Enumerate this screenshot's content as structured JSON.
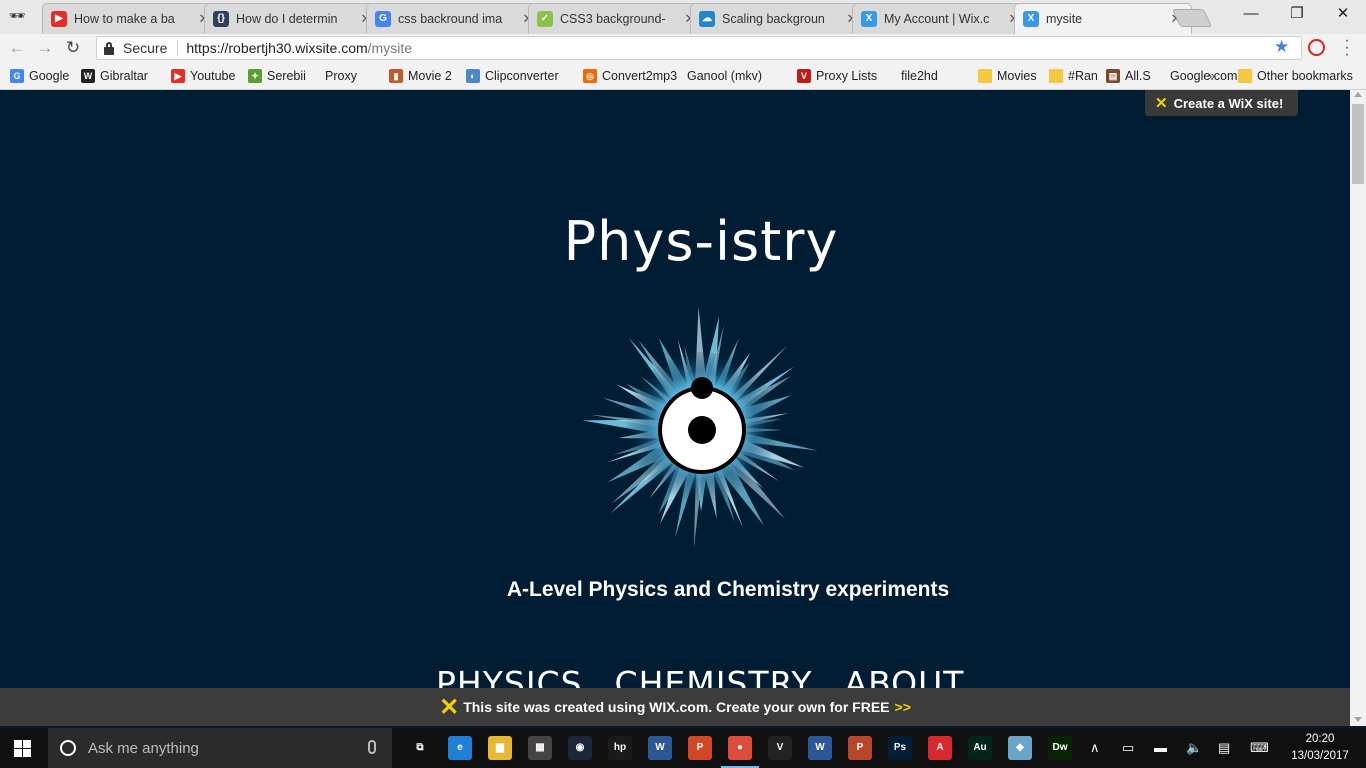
{
  "browser": {
    "tabs": [
      {
        "title": "How to make a ba",
        "icon": "youtube-icon",
        "color": "#e52d27",
        "glyph": "▶"
      },
      {
        "title": "How do I determin",
        "icon": "stackoverflow-icon",
        "color": "#2f3f5c",
        "glyph": "{}"
      },
      {
        "title": "css backround ima",
        "icon": "google-icon",
        "color": "#4285f4",
        "glyph": "G"
      },
      {
        "title": "CSS3 background-",
        "icon": "caniuse-icon",
        "color": "#8bc34a",
        "glyph": "✓"
      },
      {
        "title": "Scaling backgroun",
        "icon": "cloud-icon",
        "color": "#1e88c9",
        "glyph": "☁"
      },
      {
        "title": "My Account | Wix.c",
        "icon": "wix-icon",
        "color": "#3899ec",
        "glyph": "X"
      },
      {
        "title": "mysite",
        "icon": "wix-icon",
        "color": "#3899ec",
        "glyph": "X"
      }
    ],
    "active_tab": 6,
    "window_controls": {
      "minimize": "—",
      "maximize": "❐",
      "close": "✕"
    },
    "omnibox": {
      "secure_label": "Secure",
      "host": "https://robertjh30.wixsite.com",
      "path": "/mysite"
    },
    "bookmarks": [
      {
        "label": "Google",
        "icon": "google-icon",
        "kind": "g"
      },
      {
        "label": "Gibraltar",
        "icon": "wikipedia-icon",
        "kind": "w"
      },
      {
        "label": "Youtube",
        "icon": "youtube-icon",
        "kind": "y"
      },
      {
        "label": "Serebii",
        "icon": "serebii-icon",
        "kind": "s"
      },
      {
        "label": "Proxy",
        "icon": "page-icon",
        "kind": "page"
      },
      {
        "label": "Movie 2",
        "icon": "movie-icon",
        "kind": "m"
      },
      {
        "label": "Clipconverter",
        "icon": "clipconverter-icon",
        "kind": "c"
      },
      {
        "label": "Convert2mp3",
        "icon": "convert-icon",
        "kind": "o"
      },
      {
        "label": "Ganool (mkv)",
        "icon": "page-icon",
        "kind": "page"
      },
      {
        "label": "Proxy Lists",
        "icon": "virgin-icon",
        "kind": "v"
      },
      {
        "label": "file2hd",
        "icon": "page-icon",
        "kind": "page"
      },
      {
        "label": "Movies",
        "icon": "folder-icon",
        "kind": "folder"
      },
      {
        "label": "#Ran",
        "icon": "folder-icon",
        "kind": "folder"
      },
      {
        "label": "All.S",
        "icon": "film-icon",
        "kind": "f"
      },
      {
        "label": "Google.com",
        "icon": "page-icon",
        "kind": "page"
      }
    ],
    "bookmarks_more": "»",
    "other_bookmarks": "Other bookmarks"
  },
  "site": {
    "wix_badge": "Create a WiX site!",
    "title": "Phys-istry",
    "tagline": "A-Level Physics and Chemistry experiments",
    "nav": [
      "PHYSICS",
      "CHEMISTRY",
      "ABOUT"
    ],
    "wix_banner": {
      "text": "This site was created using WIX.com. Create your own for FREE",
      "arrows": ">>"
    }
  },
  "taskbar": {
    "search_placeholder": "Ask me anything",
    "apps": [
      {
        "name": "task-view",
        "label": "⧉",
        "color": "transparent"
      },
      {
        "name": "edge",
        "label": "e",
        "color": "#1e7fd6"
      },
      {
        "name": "file-explorer",
        "label": "▆",
        "color": "#e8b833"
      },
      {
        "name": "store",
        "label": "▦",
        "color": "#444"
      },
      {
        "name": "steam",
        "label": "◉",
        "color": "#1b2838"
      },
      {
        "name": "hp",
        "label": "hp",
        "color": "#1a1a1a"
      },
      {
        "name": "word-2013",
        "label": "W",
        "color": "#2b5797"
      },
      {
        "name": "powerpoint-2013",
        "label": "P",
        "color": "#d24726"
      },
      {
        "name": "chrome",
        "label": "●",
        "color": "#dd4b39"
      },
      {
        "name": "vectorworks",
        "label": "V",
        "color": "#222"
      },
      {
        "name": "word",
        "label": "W",
        "color": "#2b579a"
      },
      {
        "name": "powerpoint",
        "label": "P",
        "color": "#b7472a"
      },
      {
        "name": "photoshop",
        "label": "Ps",
        "color": "#001e36"
      },
      {
        "name": "acrobat",
        "label": "A",
        "color": "#d7282f"
      },
      {
        "name": "audition",
        "label": "Au",
        "color": "#00261c"
      },
      {
        "name": "sticky",
        "label": "◆",
        "color": "#6aa5c9"
      },
      {
        "name": "dreamweaver",
        "label": "Dw",
        "color": "#072401"
      }
    ],
    "time": "20:20",
    "date": "13/03/2017"
  }
}
